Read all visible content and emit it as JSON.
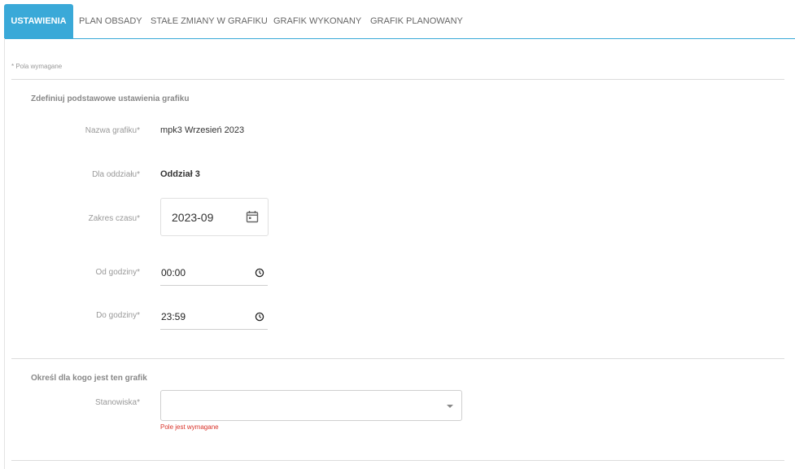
{
  "tabs": [
    {
      "label": "USTAWIENIA",
      "active": true
    },
    {
      "label": "PLAN OBSADY",
      "active": false
    },
    {
      "label": "STAŁE ZMIANY W GRAFIKU",
      "active": false
    },
    {
      "label": "GRAFIK WYKONANY",
      "active": false
    },
    {
      "label": "GRAFIK PLANOWANY",
      "active": false
    }
  ],
  "required_note": "* Pola wymagane",
  "section1": {
    "title": "Zdefiniuj podstawowe ustawienia grafiku",
    "name_label": "Nazwa grafiku*",
    "name_value": "mpk3 Wrzesień 2023",
    "department_label": "Dla oddziału*",
    "department_value": "Oddział 3",
    "range_label": "Zakres czasu*",
    "range_value": "2023-09",
    "from_label": "Od godziny*",
    "from_value": "00:00",
    "to_label": "Do godziny*",
    "to_value": "23:59"
  },
  "section2": {
    "title": "Określ dla kogo jest ten grafik",
    "positions_label": "Stanowiska*",
    "positions_value": "",
    "positions_error": "Pole jest wymagane"
  },
  "icons": {
    "calendar": "calendar-icon",
    "clock": "clock-icon",
    "dropdown": "chevron-down-icon"
  },
  "colors": {
    "accent": "#3aa9d8",
    "error": "#d9342b"
  }
}
